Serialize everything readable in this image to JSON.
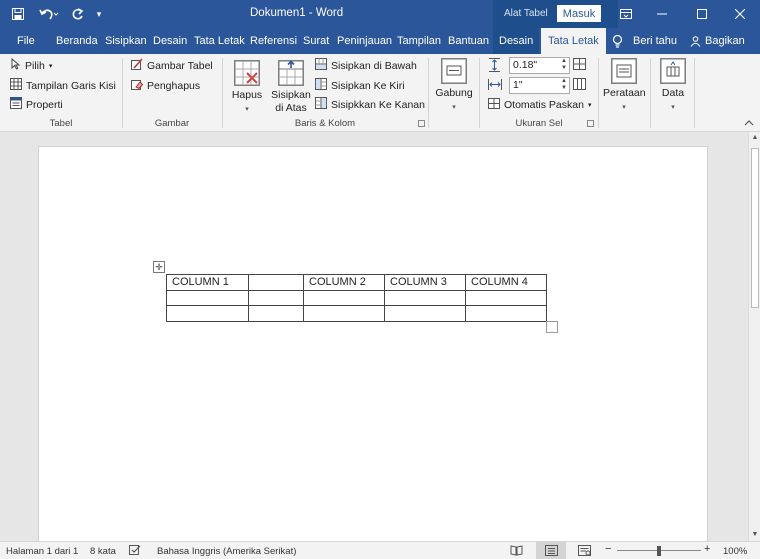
{
  "window": {
    "title": "Dokumen1  -  Word",
    "contextual_label": "Alat Tabel",
    "signin_label": "Masuk",
    "quick_access": [
      "save-icon",
      "undo-icon",
      "redo-icon",
      "customize-icon"
    ],
    "controls": [
      "ribbon-display-icon",
      "minimize-icon",
      "maximize-icon",
      "close-icon"
    ]
  },
  "tabs": {
    "file": "File",
    "beranda": "Beranda",
    "sisipkan": "Sisipkan",
    "desain": "Desain",
    "tata_letak": "Tata Letak",
    "referensi": "Referensi",
    "surat": "Surat",
    "peninjauan": "Peninjauan",
    "tampilan": "Tampilan",
    "bantuan": "Bantuan",
    "desain_tabel": "Desain",
    "tata_letak_tabel": "Tata Letak",
    "beri_tahu": "Beri tahu",
    "bagikan": "Bagikan"
  },
  "ribbon": {
    "tabel": {
      "label": "Tabel",
      "pilih": "Pilih",
      "garis_kisi": "Tampilan Garis Kisi",
      "properti": "Properti"
    },
    "gambar": {
      "label": "Gambar",
      "gambar_tabel": "Gambar Tabel",
      "penghapus": "Penghapus"
    },
    "baris_kolom": {
      "label": "Baris & Kolom",
      "hapus": "Hapus",
      "sisipkan_atas_1": "Sisipkan",
      "sisipkan_atas_2": "di Atas",
      "sisipkan_bawah": "Sisipkan di Bawah",
      "sisipkan_kiri": "Sisipkan Ke Kiri",
      "sisipkan_kanan": "Sisipkkan Ke Kanan"
    },
    "gabung": {
      "label": "Gabung"
    },
    "ukuran_sel": {
      "label": "Ukuran Sel",
      "height_value": "0.18\"",
      "width_value": "1\"",
      "autofit": "Otomatis Paskan"
    },
    "perataan": {
      "label": "Perataan"
    },
    "data": {
      "label": "Data"
    }
  },
  "document": {
    "table": {
      "rows": [
        [
          "COLUMN 1",
          "",
          "COLUMN 2",
          "COLUMN 3",
          "COLUMN 4"
        ],
        [
          "",
          "",
          "",
          "",
          ""
        ],
        [
          "",
          "",
          "",
          "",
          ""
        ]
      ]
    }
  },
  "status": {
    "page": "Halaman 1 dari 1",
    "words": "8 kata",
    "language": "Bahasa Inggris (Amerika Serikat)",
    "zoom": "100%",
    "zoom_level": 1.0
  }
}
